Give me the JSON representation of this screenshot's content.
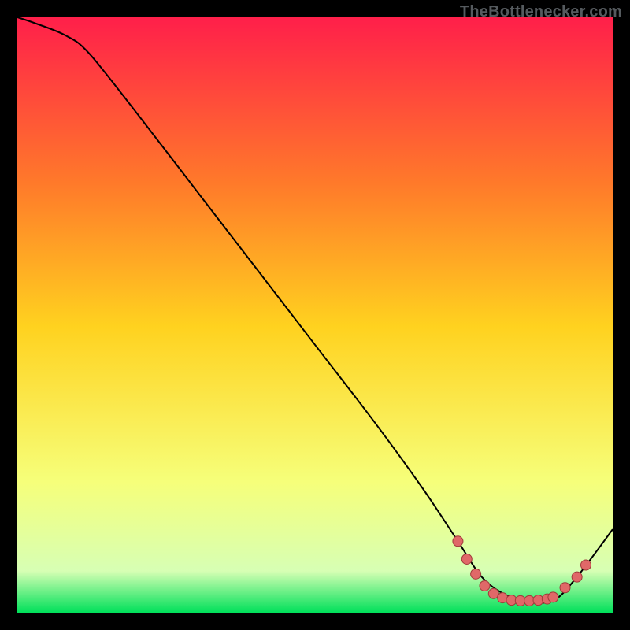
{
  "watermark": "TheBottlenecker.com",
  "colors": {
    "gradient_top": "#ff1f4a",
    "gradient_mid_upper": "#ff7a2a",
    "gradient_mid": "#ffd21f",
    "gradient_mid_lower": "#f6ff7a",
    "gradient_low": "#d7ffb4",
    "gradient_bottom": "#00e05a",
    "curve": "#000000",
    "marker_fill": "#e06868",
    "marker_stroke": "#a03a3a",
    "background": "#000000"
  },
  "chart_data": {
    "type": "line",
    "title": "",
    "xlabel": "",
    "ylabel": "",
    "xlim": [
      0,
      100
    ],
    "ylim": [
      0,
      100
    ],
    "series": [
      {
        "name": "bottleneck-curve",
        "x": [
          0,
          3,
          8,
          12,
          20,
          30,
          40,
          50,
          60,
          68,
          74,
          78,
          82,
          86,
          90,
          94,
          100
        ],
        "y": [
          100,
          99,
          97,
          94,
          84,
          71,
          58,
          45,
          32,
          21,
          12,
          6,
          3,
          2,
          2,
          6,
          14
        ]
      }
    ],
    "markers": {
      "name": "bottleneck-highlight",
      "points": [
        {
          "x": 74,
          "y": 12
        },
        {
          "x": 75.5,
          "y": 9
        },
        {
          "x": 77,
          "y": 6.5
        },
        {
          "x": 78.5,
          "y": 4.5
        },
        {
          "x": 80,
          "y": 3.2
        },
        {
          "x": 81.5,
          "y": 2.5
        },
        {
          "x": 83,
          "y": 2.1
        },
        {
          "x": 84.5,
          "y": 2.0
        },
        {
          "x": 86,
          "y": 2.0
        },
        {
          "x": 87.5,
          "y": 2.1
        },
        {
          "x": 89,
          "y": 2.3
        },
        {
          "x": 90,
          "y": 2.6
        },
        {
          "x": 92,
          "y": 4.2
        },
        {
          "x": 94,
          "y": 6.0
        },
        {
          "x": 95.5,
          "y": 8.0
        }
      ]
    }
  }
}
